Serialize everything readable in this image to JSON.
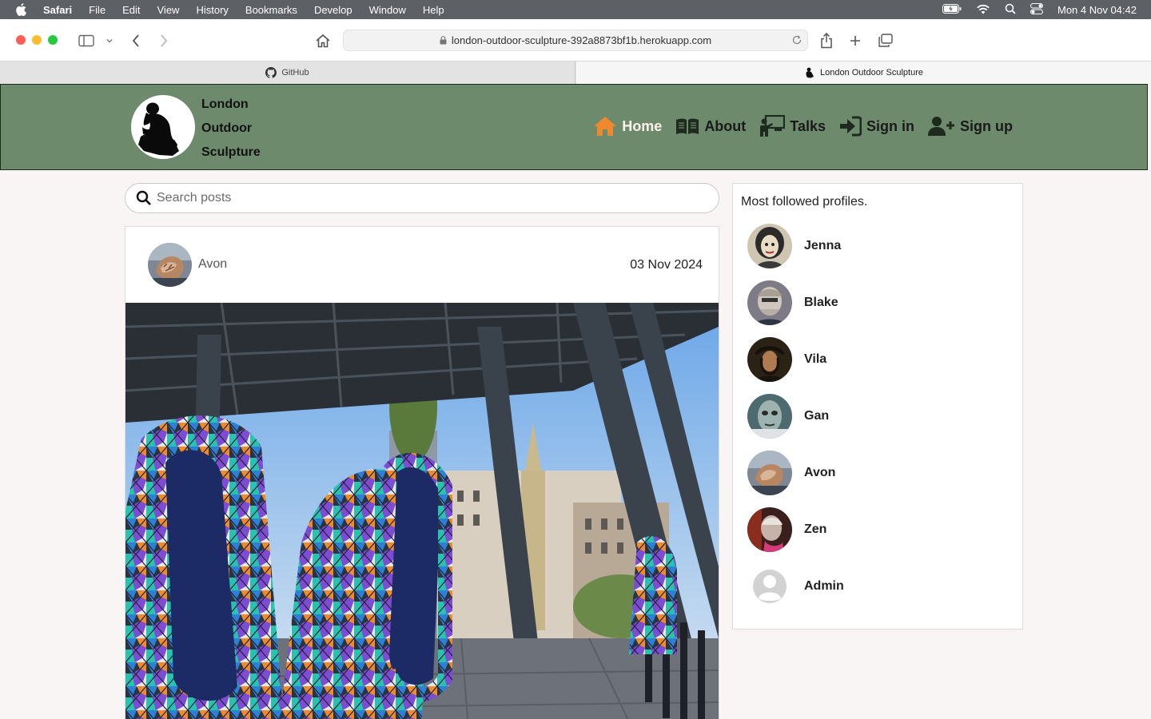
{
  "menubar": {
    "app": "Safari",
    "items": [
      "File",
      "Edit",
      "View",
      "History",
      "Bookmarks",
      "Develop",
      "Window",
      "Help"
    ],
    "clock": "Mon 4 Nov  04:42"
  },
  "browser": {
    "url": "london-outdoor-sculpture-392a8873bf1b.herokuapp.com",
    "tabs": [
      {
        "label": "GitHub",
        "icon": "github-icon"
      },
      {
        "label": "London Outdoor Sculpture",
        "icon": "thinker-icon"
      }
    ]
  },
  "site": {
    "brand": [
      "London",
      "Outdoor",
      "Sculpture"
    ],
    "nav": [
      {
        "label": "Home",
        "icon": "home-icon"
      },
      {
        "label": "About",
        "icon": "book-icon"
      },
      {
        "label": "Talks",
        "icon": "lecture-icon"
      },
      {
        "label": "Sign in",
        "icon": "sign-in-icon"
      },
      {
        "label": "Sign up",
        "icon": "user-plus-icon"
      }
    ],
    "colors": {
      "navbar": "#6d8a6c",
      "active_link": "#fbf2ea",
      "home_icon": "#f0892e"
    }
  },
  "search": {
    "placeholder": "Search posts"
  },
  "post": {
    "author": "Avon",
    "date": "03 Nov 2024"
  },
  "profiles": {
    "title": "Most followed profiles.",
    "items": [
      {
        "name": "Jenna"
      },
      {
        "name": "Blake"
      },
      {
        "name": "Vila"
      },
      {
        "name": "Gan"
      },
      {
        "name": "Avon"
      },
      {
        "name": "Zen"
      },
      {
        "name": "Admin"
      }
    ]
  }
}
